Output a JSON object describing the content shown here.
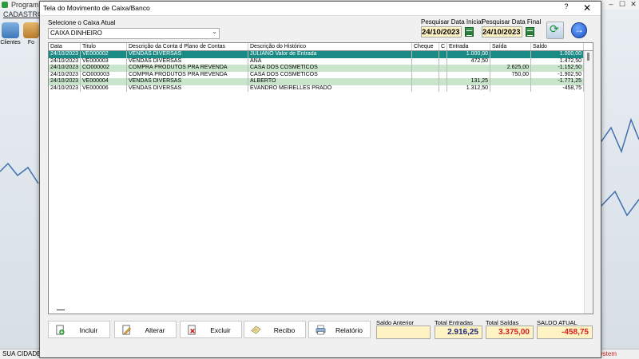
{
  "background": {
    "app_title": "Programa",
    "menu": "CADASTROS",
    "toolbar": [
      {
        "label": "Clientes",
        "icon": "clients-icon"
      },
      {
        "label": "Fo",
        "icon": "supplier-icon"
      }
    ],
    "status_left": "SUA CIDADE -",
    "status_right": "System",
    "window_controls": [
      "–",
      "☐",
      "✕"
    ]
  },
  "dialog": {
    "title": "Tela do Movimento de Caixa/Banco",
    "help": "?",
    "close": "✕",
    "select_label": "Selecione o Caixa Atual",
    "select_value": "CAIXA DINHEIRO",
    "date_start_label": "Pesquisar Data Inicial",
    "date_start": "24/10/2023",
    "date_end_label": "Pesquisar Data Final",
    "date_end": "24/10/2023"
  },
  "grid": {
    "columns": [
      "Data",
      "Titulo",
      "Descrição da Conta d Plano de Contas",
      "Descrição do Histórico",
      "Cheque",
      "C",
      "Entrada",
      "Saída",
      "Saldo"
    ],
    "rows": [
      {
        "data": "24/10/2023",
        "titulo": "VE000002",
        "conta": "VENDAS DIVERSAS",
        "historico": "JULIANO Valor de Entrada",
        "cheque": "",
        "c": "",
        "entrada": "1.000,00",
        "saida": "",
        "saldo": "1.000,00",
        "style": "sel"
      },
      {
        "data": "24/10/2023",
        "titulo": "VE000003",
        "conta": "VENDAS DIVERSAS",
        "historico": "ANA",
        "cheque": "",
        "c": "",
        "entrada": "472,50",
        "saida": "",
        "saldo": "1.472,50",
        "style": "white"
      },
      {
        "data": "24/10/2023",
        "titulo": "CO000002",
        "conta": "COMPRA PRODUTOS PRA REVENDA",
        "historico": "CASA DOS COSMETICOS",
        "cheque": "",
        "c": "",
        "entrada": "",
        "saida": "2.625,00",
        "saldo": "-1.152,50",
        "style": "green"
      },
      {
        "data": "24/10/2023",
        "titulo": "CO000003",
        "conta": "COMPRA PRODUTOS PRA REVENDA",
        "historico": "CASA DOS COSMETICOS",
        "cheque": "",
        "c": "",
        "entrada": "",
        "saida": "750,00",
        "saldo": "-1.902,50",
        "style": "white"
      },
      {
        "data": "24/10/2023",
        "titulo": "VE000004",
        "conta": "VENDAS DIVERSAS",
        "historico": "ALBERTO",
        "cheque": "",
        "c": "",
        "entrada": "131,25",
        "saida": "",
        "saldo": "-1.771,25",
        "style": "green"
      },
      {
        "data": "24/10/2023",
        "titulo": "VE000006",
        "conta": "VENDAS DIVERSAS",
        "historico": "EVANDRO MEIRELLES PRADO",
        "cheque": "",
        "c": "",
        "entrada": "1.312,50",
        "saida": "",
        "saldo": "-458,75",
        "style": "white"
      }
    ]
  },
  "buttons": {
    "incluir": "Incluir",
    "alterar": "Alterar",
    "excluir": "Excluir",
    "recibo": "Recibo",
    "relatorio": "Relatório"
  },
  "summary": {
    "saldo_anterior_label": "Saldo Anterior",
    "saldo_anterior": "",
    "total_entradas_label": "Total Entradas",
    "total_entradas": "2.916,25",
    "total_saidas_label": "Total Saídas",
    "total_saidas": "3.375,00",
    "saldo_atual_label": "SALDO ATUAL",
    "saldo_atual": "-458,75"
  },
  "colors": {
    "selected_row": "#1a8a85",
    "green_row": "#c9e6cc",
    "entradas_text": "#1f2a7a",
    "saidas_text": "#d61f1f",
    "saldo_atual_text": "#d61f1f"
  }
}
